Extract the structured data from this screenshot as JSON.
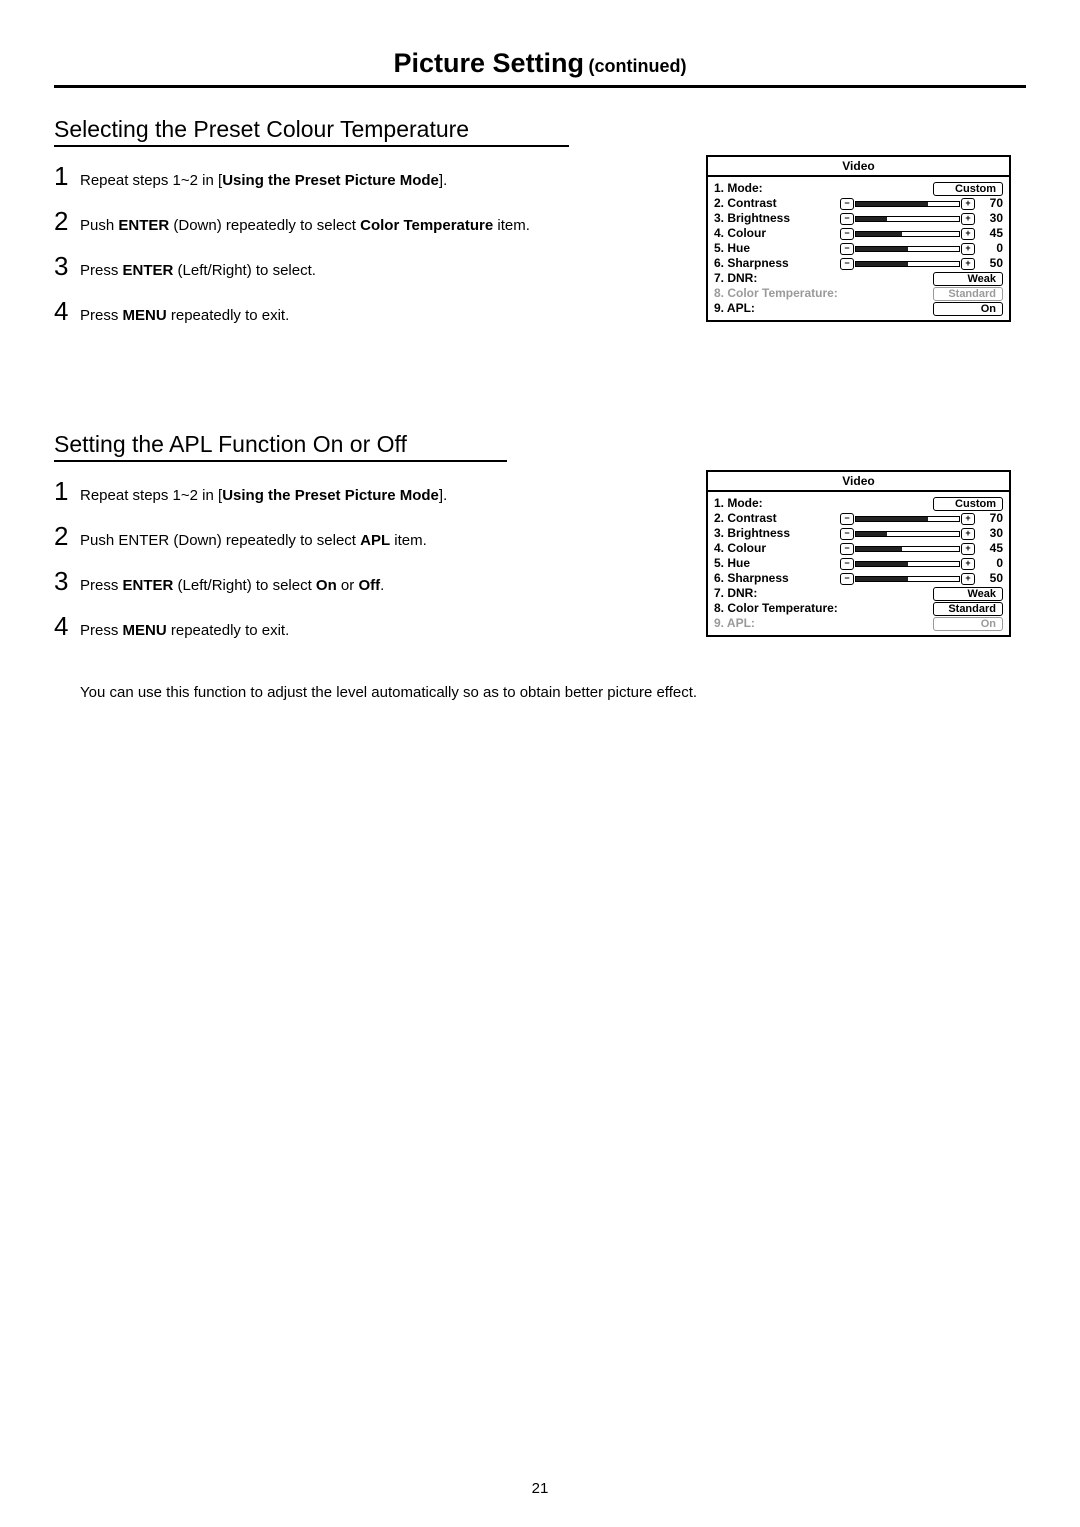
{
  "page": {
    "title": "Picture Setting",
    "subtitle": "(continued)",
    "number": "21"
  },
  "section1": {
    "heading": "Selecting the Preset Colour Temperature",
    "steps": {
      "s1": {
        "num": "1",
        "pre": "Repeat steps 1~2 in [",
        "bold": "Using the Preset Picture Mode",
        "post": "]."
      },
      "s2": {
        "num": "2",
        "pre": "Push ",
        "b1": "ENTER",
        "mid": " (Down) repeatedly to select ",
        "b2": "Color Temperature",
        "post": " item."
      },
      "s3": {
        "num": "3",
        "pre": "Press ",
        "b1": "ENTER",
        "post": " (Left/Right) to select."
      },
      "s4": {
        "num": "4",
        "pre": "Press ",
        "b1": "MENU",
        "post": " repeatedly to exit."
      }
    },
    "osd": {
      "title": "Video",
      "rows": {
        "mode": {
          "label": "1. Mode:",
          "value": "Custom"
        },
        "contrast": {
          "label": "2. Contrast",
          "value": "70",
          "fill": 70
        },
        "brightness": {
          "label": "3. Brightness",
          "value": "30",
          "fill": 30
        },
        "colour": {
          "label": "4. Colour",
          "value": "45",
          "fill": 45
        },
        "hue": {
          "label": "5. Hue",
          "value": "0",
          "fill": 50
        },
        "sharpness": {
          "label": "6. Sharpness",
          "value": "50",
          "fill": 50
        },
        "dnr": {
          "label": "7. DNR:",
          "value": "Weak"
        },
        "colortemp": {
          "label": "8. Color Temperature:",
          "value": "Standard"
        },
        "apl": {
          "label": "9. APL:",
          "value": "On"
        }
      },
      "highlight": "colortemp"
    }
  },
  "section2": {
    "heading": "Setting the APL Function On or Off",
    "steps": {
      "s1": {
        "num": "1",
        "pre": "Repeat steps 1~2 in [",
        "bold": "Using the Preset Picture Mode",
        "post": "]."
      },
      "s2": {
        "num": "2",
        "pre": "Push ENTER (Down) repeatedly to select ",
        "b1": "APL",
        "post": " item."
      },
      "s3": {
        "num": "3",
        "pre": "Press ",
        "b1": "ENTER",
        "mid": " (Left/Right) to select ",
        "b2": "On",
        "mid2": " or ",
        "b3": "Off",
        "post": "."
      },
      "s4": {
        "num": "4",
        "pre": "Press ",
        "b1": "MENU",
        "post": " repeatedly to exit."
      }
    },
    "note": "You can use this function to adjust the level automatically so as to obtain better picture effect.",
    "osd": {
      "title": "Video",
      "rows": {
        "mode": {
          "label": "1. Mode:",
          "value": "Custom"
        },
        "contrast": {
          "label": "2. Contrast",
          "value": "70",
          "fill": 70
        },
        "brightness": {
          "label": "3. Brightness",
          "value": "30",
          "fill": 30
        },
        "colour": {
          "label": "4. Colour",
          "value": "45",
          "fill": 45
        },
        "hue": {
          "label": "5. Hue",
          "value": "0",
          "fill": 50
        },
        "sharpness": {
          "label": "6. Sharpness",
          "value": "50",
          "fill": 50
        },
        "dnr": {
          "label": "7. DNR:",
          "value": "Weak"
        },
        "colortemp": {
          "label": "8. Color Temperature:",
          "value": "Standard"
        },
        "apl": {
          "label": "9. APL:",
          "value": "On"
        }
      },
      "highlight": "apl"
    }
  },
  "icons": {
    "minus": "−",
    "plus": "+"
  }
}
